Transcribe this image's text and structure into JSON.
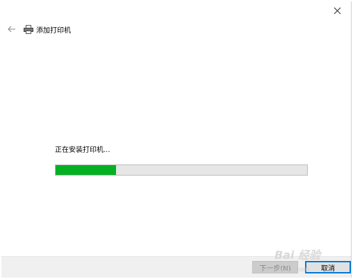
{
  "window": {
    "title": "添加打印机",
    "status_text": "正在安装打印机...",
    "progress_fraction": 0.24
  },
  "buttons": {
    "next_label": "下一步(N)",
    "cancel_label": "取消"
  },
  "watermark": {
    "main": "Bai 经验",
    "sub": "jingyan.baidu.com"
  },
  "icons": {
    "close": "close-icon",
    "back": "back-arrow-icon",
    "printer": "printer-icon"
  },
  "colors": {
    "progress": "#06b025",
    "accent": "#0078d7"
  }
}
